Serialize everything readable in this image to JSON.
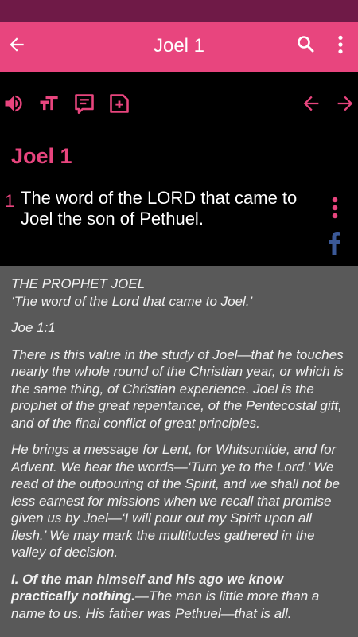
{
  "app_bar": {
    "title": "Joel 1"
  },
  "chapter_title": "Joel 1",
  "verse": {
    "number": "1",
    "text": "The word of the LORD that came to Joel the son of Pethuel."
  },
  "commentary": {
    "heading": "THE PROPHET JOEL",
    "quote": "‘The word of the Lord that came to Joel.’",
    "ref": "Joe 1:1",
    "p1": "There is this value in the study of Joel—that he touches nearly the whole round of the Christian year, or which is the same thing, of Christian experience. Joel is the prophet of the great repentance, of the Pentecostal gift, and of the final conflict of great principles.",
    "p2": "He brings a message for Lent, for Whitsuntide, and for Advent. We hear the words—‘Turn ye to the Lord.’ We read of the outpouring of the Spirit, and we shall not be less earnest for missions when we recall that promise given us by Joel—‘I will pour out my Spirit upon all flesh.’ We may mark the multitudes gathered in the valley of decision.",
    "p3_bold": "I. Of the man himself and his ago we know practically nothing.",
    "p3_rest": "—The man is little more than a name to us. His father was Pethuel—that is all."
  },
  "colors": {
    "accent": "#e8457e",
    "status_bar": "#6f1a47",
    "commentary_bg": "#595959",
    "facebook": "#3b5998"
  }
}
